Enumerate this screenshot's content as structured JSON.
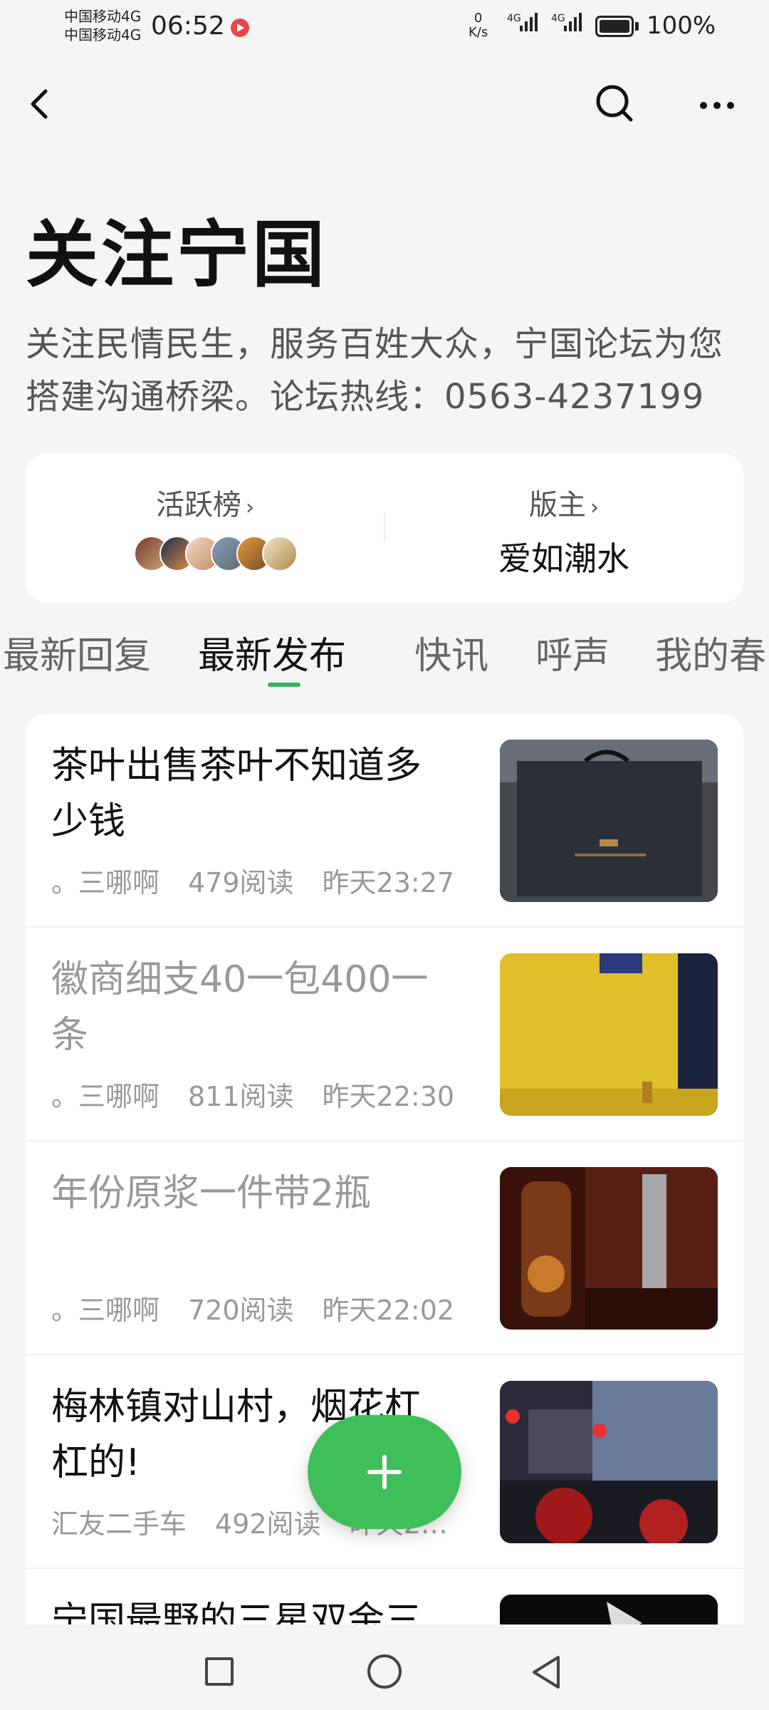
{
  "status_bar": {
    "carrier_1": "中国移动4G",
    "carrier_2": "中国移动4G",
    "time": "06:52",
    "net_speed_value": "0",
    "net_speed_unit": "K/s",
    "signal_1_tag": "4G",
    "signal_2_tag": "4G",
    "battery": "100%",
    "battery_level": 1.0
  },
  "nav": {
    "back_icon": "chevron-left",
    "search_icon": "search",
    "more_icon": "more-horizontal"
  },
  "page": {
    "title": "关注宁国",
    "description_line_1": "关注民情民生，服务百姓大众，宁国论坛为您",
    "description_line_2": "搭建沟通桥梁。论坛热线：0563-4237199"
  },
  "info_card": {
    "active_label": "活跃榜",
    "moderator_label": "版主",
    "moderator_name": "爱如潮水",
    "chevron": "›"
  },
  "tabs": [
    {
      "label": "最新回复",
      "active": false
    },
    {
      "label": "最新发布",
      "active": true
    },
    {
      "label": "快讯",
      "active": false
    },
    {
      "label": "呼声",
      "active": false
    },
    {
      "label": "我的春",
      "active": false
    }
  ],
  "posts": [
    {
      "title_line_1": "茶叶出售茶叶不知道多",
      "title_line_2": "少钱",
      "author": "。三哪啊",
      "reads": "479阅读",
      "time": "昨天23:27",
      "read": false
    },
    {
      "title_line_1": "徽商细支40一包400一",
      "title_line_2": "条",
      "author": "。三哪啊",
      "reads": "811阅读",
      "time": "昨天22:30",
      "read": true
    },
    {
      "title_line_1": "年份原浆一件带2瓶",
      "title_line_2": "",
      "author": "。三哪啊",
      "reads": "720阅读",
      "time": "昨天22:02",
      "read": true
    },
    {
      "title_line_1": "梅林镇对山村，烟花杠",
      "title_line_2": "杠的!",
      "author": "汇友二手车",
      "reads": "492阅读",
      "time": "昨天2…",
      "read": false
    },
    {
      "title_line_1": "宁国最野的三星双金三",
      "title_line_2": "",
      "author": "",
      "reads": "",
      "time": "",
      "read": false
    }
  ],
  "fab": {
    "icon": "plus"
  },
  "system_nav": {
    "recents_icon": "square",
    "home_icon": "circle",
    "back_icon": "triangle-left"
  }
}
